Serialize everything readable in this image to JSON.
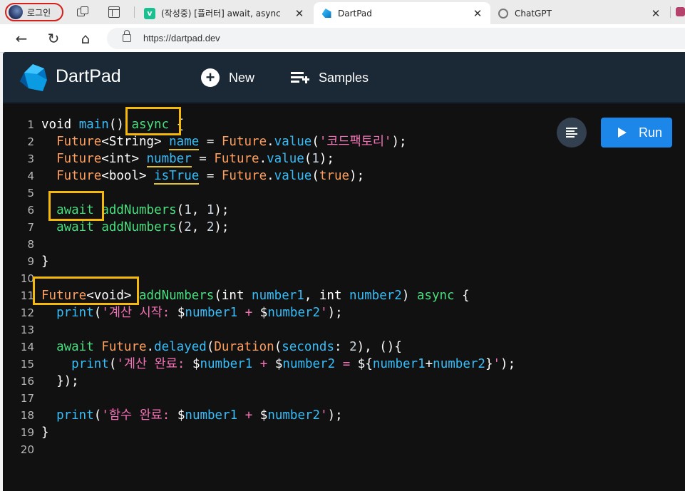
{
  "browser": {
    "profile_label": "로그인",
    "tabs": [
      {
        "title": "(작성중) [플러터] await, async",
        "favicon": "v-icon"
      },
      {
        "title": "DartPad",
        "favicon": "dart-icon"
      },
      {
        "title": "ChatGPT",
        "favicon": "chatgpt-icon"
      }
    ],
    "url": "https://dartpad.dev"
  },
  "app": {
    "brand": "DartPad",
    "new_label": "New",
    "samples_label": "Samples",
    "run_label": "Run",
    "accent_color": "#1c87e8"
  },
  "code": [
    {
      "n": "1",
      "tokens": [
        {
          "t": "void ",
          "c": "kw"
        },
        {
          "t": "main",
          "c": "fn"
        },
        {
          "t": "() ",
          "c": "kw"
        },
        {
          "t": "async",
          "c": "grn"
        },
        {
          "t": " {",
          "c": "kw"
        }
      ]
    },
    {
      "n": "2",
      "tokens": [
        {
          "t": "  ",
          "c": "kw"
        },
        {
          "t": "Future",
          "c": "ty"
        },
        {
          "t": "<String> ",
          "c": "kw"
        },
        {
          "t": "name",
          "c": "var warn"
        },
        {
          "t": " = ",
          "c": "kw"
        },
        {
          "t": "Future",
          "c": "ty"
        },
        {
          "t": ".",
          "c": "kw"
        },
        {
          "t": "value",
          "c": "fn"
        },
        {
          "t": "(",
          "c": "kw"
        },
        {
          "t": "'코드팩토리'",
          "c": "str"
        },
        {
          "t": ");",
          "c": "kw"
        }
      ]
    },
    {
      "n": "3",
      "tokens": [
        {
          "t": "  ",
          "c": "kw"
        },
        {
          "t": "Future",
          "c": "ty"
        },
        {
          "t": "<int> ",
          "c": "kw"
        },
        {
          "t": "number",
          "c": "var warn"
        },
        {
          "t": " = ",
          "c": "kw"
        },
        {
          "t": "Future",
          "c": "ty"
        },
        {
          "t": ".",
          "c": "kw"
        },
        {
          "t": "value",
          "c": "fn"
        },
        {
          "t": "(",
          "c": "kw"
        },
        {
          "t": "1",
          "c": "num"
        },
        {
          "t": ");",
          "c": "kw"
        }
      ]
    },
    {
      "n": "4",
      "tokens": [
        {
          "t": "  ",
          "c": "kw"
        },
        {
          "t": "Future",
          "c": "ty"
        },
        {
          "t": "<bool> ",
          "c": "kw"
        },
        {
          "t": "isTrue",
          "c": "var warn"
        },
        {
          "t": " = ",
          "c": "kw"
        },
        {
          "t": "Future",
          "c": "ty"
        },
        {
          "t": ".",
          "c": "kw"
        },
        {
          "t": "value",
          "c": "fn"
        },
        {
          "t": "(",
          "c": "kw"
        },
        {
          "t": "true",
          "c": "ty"
        },
        {
          "t": ");",
          "c": "kw"
        }
      ]
    },
    {
      "n": "5",
      "tokens": []
    },
    {
      "n": "6",
      "tokens": [
        {
          "t": "  ",
          "c": "kw"
        },
        {
          "t": "await",
          "c": "grn"
        },
        {
          "t": " ",
          "c": "kw"
        },
        {
          "t": "addNumbers",
          "c": "grn"
        },
        {
          "t": "(",
          "c": "kw"
        },
        {
          "t": "1",
          "c": "num"
        },
        {
          "t": ", ",
          "c": "kw"
        },
        {
          "t": "1",
          "c": "num"
        },
        {
          "t": ");",
          "c": "kw"
        }
      ]
    },
    {
      "n": "7",
      "tokens": [
        {
          "t": "  ",
          "c": "kw"
        },
        {
          "t": "await",
          "c": "grn"
        },
        {
          "t": " ",
          "c": "kw"
        },
        {
          "t": "addNumbers",
          "c": "grn"
        },
        {
          "t": "(",
          "c": "kw"
        },
        {
          "t": "2",
          "c": "num"
        },
        {
          "t": ", ",
          "c": "kw"
        },
        {
          "t": "2",
          "c": "num"
        },
        {
          "t": ");",
          "c": "kw"
        }
      ]
    },
    {
      "n": "8",
      "tokens": []
    },
    {
      "n": "9",
      "tokens": [
        {
          "t": "}",
          "c": "kw"
        }
      ]
    },
    {
      "n": "10",
      "tokens": []
    },
    {
      "n": "11",
      "tokens": [
        {
          "t": "Future",
          "c": "ty"
        },
        {
          "t": "<void> ",
          "c": "kw"
        },
        {
          "t": "addNumbers",
          "c": "grn"
        },
        {
          "t": "(",
          "c": "kw"
        },
        {
          "t": "int",
          "c": "kw"
        },
        {
          "t": " ",
          "c": "kw"
        },
        {
          "t": "number1",
          "c": "var"
        },
        {
          "t": ", ",
          "c": "kw"
        },
        {
          "t": "int",
          "c": "kw"
        },
        {
          "t": " ",
          "c": "kw"
        },
        {
          "t": "number2",
          "c": "var"
        },
        {
          "t": ") ",
          "c": "kw"
        },
        {
          "t": "async",
          "c": "grn"
        },
        {
          "t": " {",
          "c": "kw"
        }
      ]
    },
    {
      "n": "12",
      "tokens": [
        {
          "t": "  ",
          "c": "kw"
        },
        {
          "t": "print",
          "c": "fn"
        },
        {
          "t": "(",
          "c": "kw"
        },
        {
          "t": "'계산 시작: ",
          "c": "str"
        },
        {
          "t": "$",
          "c": "kw"
        },
        {
          "t": "number1",
          "c": "var"
        },
        {
          "t": " + ",
          "c": "str"
        },
        {
          "t": "$",
          "c": "kw"
        },
        {
          "t": "number2",
          "c": "var"
        },
        {
          "t": "'",
          "c": "str"
        },
        {
          "t": ");",
          "c": "kw"
        }
      ]
    },
    {
      "n": "13",
      "tokens": []
    },
    {
      "n": "14",
      "tokens": [
        {
          "t": "  ",
          "c": "kw"
        },
        {
          "t": "await",
          "c": "grn"
        },
        {
          "t": " ",
          "c": "kw"
        },
        {
          "t": "Future",
          "c": "ty"
        },
        {
          "t": ".",
          "c": "kw"
        },
        {
          "t": "delayed",
          "c": "fn"
        },
        {
          "t": "(",
          "c": "kw"
        },
        {
          "t": "Duration",
          "c": "ty"
        },
        {
          "t": "(",
          "c": "kw"
        },
        {
          "t": "seconds",
          "c": "var"
        },
        {
          "t": ": ",
          "c": "kw"
        },
        {
          "t": "2",
          "c": "num"
        },
        {
          "t": "), (){",
          "c": "kw"
        }
      ]
    },
    {
      "n": "15",
      "tokens": [
        {
          "t": "    ",
          "c": "kw"
        },
        {
          "t": "print",
          "c": "fn"
        },
        {
          "t": "(",
          "c": "kw"
        },
        {
          "t": "'계산 완료: ",
          "c": "str"
        },
        {
          "t": "$",
          "c": "kw"
        },
        {
          "t": "number1",
          "c": "var"
        },
        {
          "t": " + ",
          "c": "str"
        },
        {
          "t": "$",
          "c": "kw"
        },
        {
          "t": "number2",
          "c": "var"
        },
        {
          "t": " = ",
          "c": "str"
        },
        {
          "t": "${",
          "c": "kw"
        },
        {
          "t": "number1",
          "c": "var"
        },
        {
          "t": "+",
          "c": "kw"
        },
        {
          "t": "number2",
          "c": "var"
        },
        {
          "t": "}",
          "c": "kw"
        },
        {
          "t": "'",
          "c": "str"
        },
        {
          "t": ");",
          "c": "kw"
        }
      ]
    },
    {
      "n": "16",
      "tokens": [
        {
          "t": "  });",
          "c": "kw"
        }
      ]
    },
    {
      "n": "17",
      "tokens": []
    },
    {
      "n": "18",
      "tokens": [
        {
          "t": "  ",
          "c": "kw"
        },
        {
          "t": "print",
          "c": "fn"
        },
        {
          "t": "(",
          "c": "kw"
        },
        {
          "t": "'함수 완료: ",
          "c": "str"
        },
        {
          "t": "$",
          "c": "kw"
        },
        {
          "t": "number1",
          "c": "var"
        },
        {
          "t": " + ",
          "c": "str"
        },
        {
          "t": "$",
          "c": "kw"
        },
        {
          "t": "number2",
          "c": "var"
        },
        {
          "t": "'",
          "c": "str"
        },
        {
          "t": ");",
          "c": "kw"
        }
      ]
    },
    {
      "n": "19",
      "tokens": [
        {
          "t": "}",
          "c": "kw"
        }
      ]
    },
    {
      "n": "20",
      "tokens": []
    }
  ]
}
